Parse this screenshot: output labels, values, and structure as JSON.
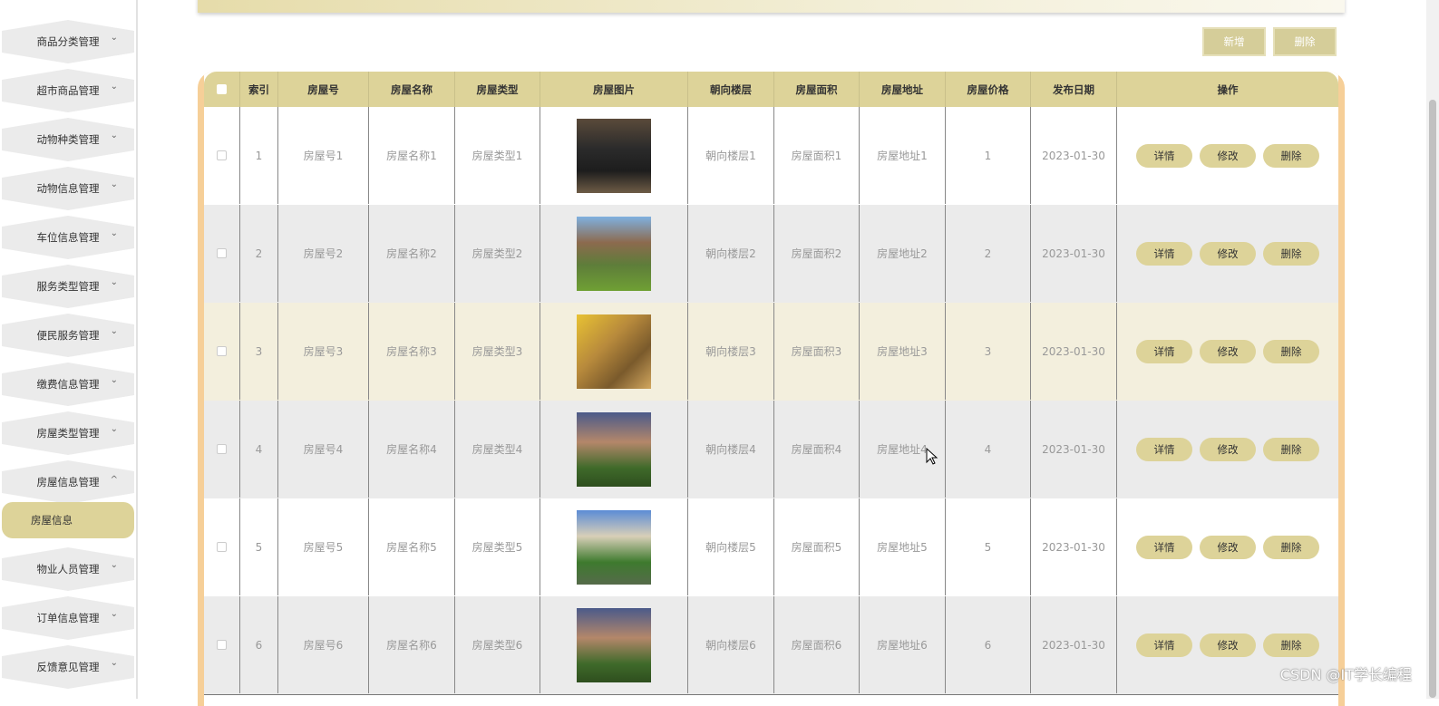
{
  "sidebar": {
    "items": [
      {
        "label": "商品分类管理"
      },
      {
        "label": "超市商品管理"
      },
      {
        "label": "动物种类管理"
      },
      {
        "label": "动物信息管理"
      },
      {
        "label": "车位信息管理"
      },
      {
        "label": "服务类型管理"
      },
      {
        "label": "便民服务管理"
      },
      {
        "label": "缴费信息管理"
      },
      {
        "label": "房屋类型管理"
      },
      {
        "label": "房屋信息管理"
      }
    ],
    "active_sub": "房屋信息",
    "items_after": [
      {
        "label": "物业人员管理"
      },
      {
        "label": "订单信息管理"
      },
      {
        "label": "反馈意见管理"
      }
    ]
  },
  "toolbar": {
    "add_label": "新增",
    "delete_label": "删除"
  },
  "table": {
    "headers": [
      "索引",
      "房屋号",
      "房屋名称",
      "房屋类型",
      "房屋图片",
      "朝向楼层",
      "房屋面积",
      "房屋地址",
      "房屋价格",
      "发布日期",
      "操作"
    ],
    "rows": [
      {
        "index": "1",
        "number": "房屋号1",
        "name": "房屋名称1",
        "type": "房屋类型1",
        "floor": "朝向楼层1",
        "area": "房屋面积1",
        "address": "房屋地址1",
        "price": "1",
        "date": "2023-01-30"
      },
      {
        "index": "2",
        "number": "房屋号2",
        "name": "房屋名称2",
        "type": "房屋类型2",
        "floor": "朝向楼层2",
        "area": "房屋面积2",
        "address": "房屋地址2",
        "price": "2",
        "date": "2023-01-30"
      },
      {
        "index": "3",
        "number": "房屋号3",
        "name": "房屋名称3",
        "type": "房屋类型3",
        "floor": "朝向楼层3",
        "area": "房屋面积3",
        "address": "房屋地址3",
        "price": "3",
        "date": "2023-01-30"
      },
      {
        "index": "4",
        "number": "房屋号4",
        "name": "房屋名称4",
        "type": "房屋类型4",
        "floor": "朝向楼层4",
        "area": "房屋面积4",
        "address": "房屋地址4",
        "price": "4",
        "date": "2023-01-30"
      },
      {
        "index": "5",
        "number": "房屋号5",
        "name": "房屋名称5",
        "type": "房屋类型5",
        "floor": "朝向楼层5",
        "area": "房屋面积5",
        "address": "房屋地址5",
        "price": "5",
        "date": "2023-01-30"
      },
      {
        "index": "6",
        "number": "房屋号6",
        "name": "房屋名称6",
        "type": "房屋类型6",
        "floor": "朝向楼层6",
        "area": "房屋面积6",
        "address": "房屋地址6",
        "price": "6",
        "date": "2023-01-30"
      }
    ],
    "actions": {
      "detail": "详情",
      "edit": "修改",
      "delete": "删除"
    }
  },
  "watermark": "CSDN @IT学长编程",
  "colors": {
    "accent": "#ddd399",
    "table_border": "#f6cf98",
    "row_alt": "#ebebeb",
    "row_highlight": "#f3efdd"
  }
}
